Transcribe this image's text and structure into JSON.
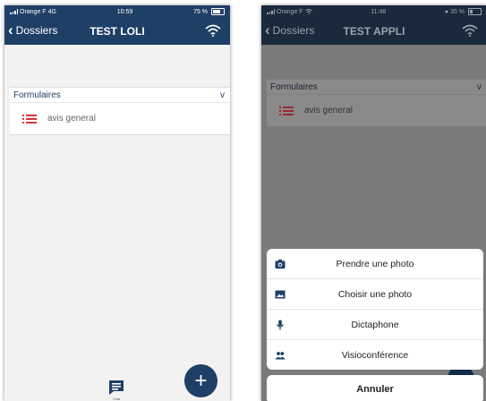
{
  "left": {
    "status": {
      "carrier": "Orange F",
      "network": "4G",
      "time": "10:59",
      "battery": "75 %"
    },
    "nav": {
      "back_label": "Dossiers",
      "title": "TEST LOLI"
    },
    "list": {
      "header": "Formulaires",
      "header_toggle": "v",
      "items": [
        {
          "label": "avis general"
        }
      ]
    },
    "chat_label": "Chat",
    "fab_label": "+"
  },
  "right": {
    "status": {
      "carrier": "Orange F",
      "time": "11:48",
      "battery": "35 %"
    },
    "nav": {
      "back_label": "Dossiers",
      "title": "TEST APPLI"
    },
    "list": {
      "header": "Formulaires",
      "header_toggle": "v",
      "items": [
        {
          "label": "avis general"
        }
      ]
    },
    "action_sheet": {
      "options": [
        {
          "label": "Prendre une photo",
          "icon": "camera-icon"
        },
        {
          "label": "Choisir une photo",
          "icon": "image-icon"
        },
        {
          "label": "Dictaphone",
          "icon": "microphone-icon"
        },
        {
          "label": "Visioconférence",
          "icon": "people-icon"
        }
      ],
      "cancel_label": "Annuler"
    }
  },
  "colors": {
    "navbar": "#1e3f66",
    "list_icon": "#e0303a",
    "fab": "#1e3f66"
  }
}
